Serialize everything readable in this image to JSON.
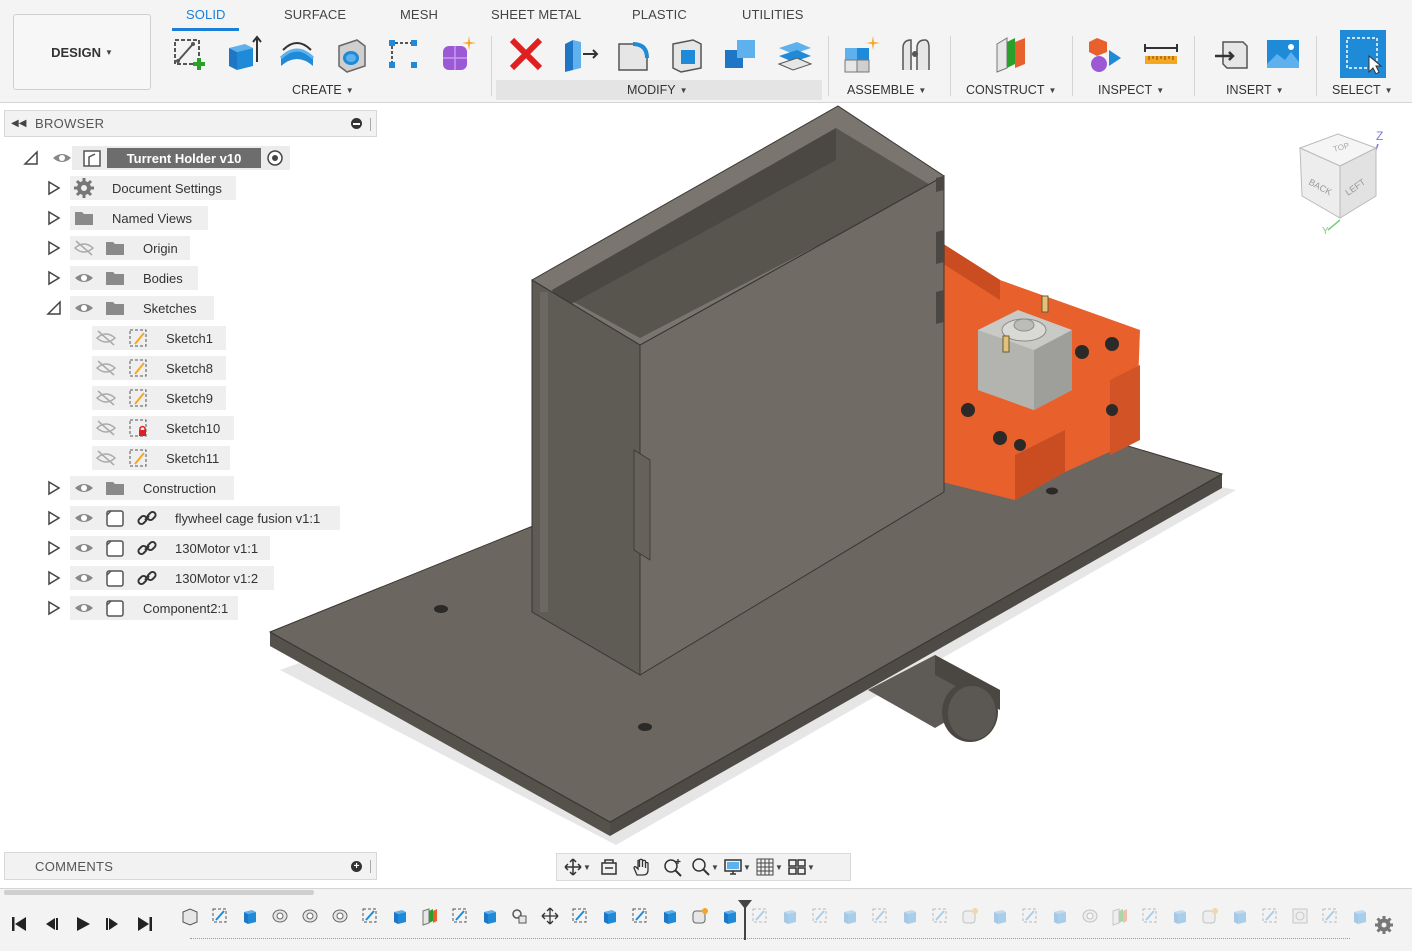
{
  "toolbar": {
    "workspace": "DESIGN",
    "tabs": [
      "SOLID",
      "SURFACE",
      "MESH",
      "SHEET METAL",
      "PLASTIC",
      "UTILITIES"
    ],
    "active_tab": "SOLID",
    "groups": {
      "create": "CREATE",
      "modify": "MODIFY",
      "assemble": "ASSEMBLE",
      "construct": "CONSTRUCT",
      "inspect": "INSPECT",
      "insert": "INSERT",
      "select": "SELECT"
    },
    "colors": {
      "accent": "#1a7fd8",
      "delete": "#e02020",
      "tool_blue": "#1f8ad8"
    }
  },
  "browser": {
    "title": "BROWSER",
    "root": "Turrent Holder v10",
    "items": [
      {
        "label": "Document Settings"
      },
      {
        "label": "Named Views"
      },
      {
        "label": "Origin"
      },
      {
        "label": "Bodies"
      },
      {
        "label": "Sketches"
      },
      {
        "label": "Construction"
      },
      {
        "label": "flywheel cage fusion v1:1"
      },
      {
        "label": "130Motor v1:1"
      },
      {
        "label": "130Motor v1:2"
      },
      {
        "label": "Component2:1"
      }
    ],
    "sketches": [
      "Sketch1",
      "Sketch8",
      "Sketch9",
      "Sketch10",
      "Sketch11"
    ]
  },
  "comments": {
    "title": "COMMENTS"
  },
  "viewcube": {
    "faces": [
      "TOP",
      "BACK",
      "LEFT"
    ],
    "axes": [
      "Z",
      "Y"
    ]
  },
  "model": {
    "colors": {
      "plate": "#6b665f",
      "box": "#6f6b64",
      "cage": "#e8602c",
      "motor": "#c9c9c6"
    }
  }
}
